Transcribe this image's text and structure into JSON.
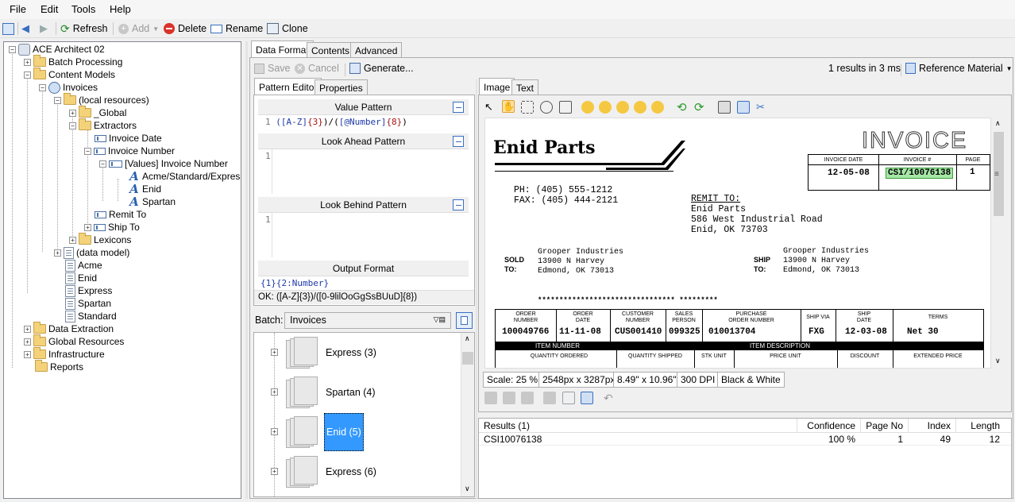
{
  "menu": [
    "File",
    "Edit",
    "Tools",
    "Help"
  ],
  "toolbar": {
    "refresh": "Refresh",
    "add": "Add",
    "delete": "Delete",
    "rename": "Rename",
    "clone": "Clone"
  },
  "tree": {
    "root": "ACE Architect 02",
    "batch_processing": "Batch Processing",
    "content_models": "Content Models",
    "invoices": "Invoices",
    "local_resources": "(local resources)",
    "global": "_Global",
    "extractors": "Extractors",
    "invoice_date": "Invoice Date",
    "invoice_number": "Invoice Number",
    "values_invoice_number": "[Values] Invoice Number",
    "acme": "Acme/Standard/Express",
    "enid": "Enid",
    "spartan": "Spartan",
    "remit_to": "Remit To",
    "ship_to": "Ship To",
    "lexicons": "Lexicons",
    "data_model": "(data model)",
    "acme2": "Acme",
    "enid2": "Enid",
    "express": "Express",
    "spartan2": "Spartan",
    "standard": "Standard",
    "data_extraction": "Data Extraction",
    "global_resources": "Global Resources",
    "infrastructure": "Infrastructure",
    "reports": "Reports"
  },
  "main_tabs": [
    "Data Format",
    "Contents",
    "Advanced"
  ],
  "actions": {
    "save": "Save",
    "cancel": "Cancel",
    "generate": "Generate...",
    "results_timing": "1 results in 3 ms",
    "reference": "Reference Material"
  },
  "editor_tabs": [
    "Pattern Editor",
    "Properties"
  ],
  "value_pattern": {
    "title": "Value Pattern",
    "line": "1",
    "code_a": "([A-Z]",
    "code_b": "{3}",
    "code_c": ")/(",
    "code_d": "[@Number]",
    "code_e": "{8}",
    "code_f": ")"
  },
  "look_ahead": {
    "title": "Look Ahead Pattern",
    "line": "1"
  },
  "look_behind": {
    "title": "Look Behind Pattern",
    "line": "1"
  },
  "output_format": {
    "title": "Output Format",
    "value": "{1}{2:Number}",
    "ok_text": "OK: ([A-Z]{3})/([0-9lilOoGgSsBUuD]{8})"
  },
  "batch": {
    "label": "Batch:",
    "selected": "Invoices",
    "items": [
      "Express (3)",
      "Spartan (4)",
      "Enid (5)",
      "Express (6)"
    ]
  },
  "viewer_tabs": [
    "Image",
    "Text"
  ],
  "status": {
    "scale": "Scale: 25 %",
    "pixels": "2548px x 3287px",
    "inches": "8.49\" x 10.96\"",
    "dpi": "300 DPI",
    "mode": "Black & White"
  },
  "invoice": {
    "company": "Enid Parts",
    "title": "INVOICE",
    "ph": "PH:  (405) 555-1212",
    "fax": "FAX: (405) 444-2121",
    "remit_to_label": "REMIT TO:",
    "remit_lines": [
      "Enid Parts",
      "586 West Industrial Road",
      "Enid, OK 73703"
    ],
    "head_labels": [
      "INVOICE DATE",
      "INVOICE #",
      "PAGE"
    ],
    "head_values": [
      "12-05-08",
      "CSI/10076138",
      "1"
    ],
    "sold_label": "SOLD\nTO:",
    "ship_label": "SHIP\nTO:",
    "sold_lines": [
      "Grooper Industries",
      "13900 N Harvey",
      "Edmond, OK 73013"
    ],
    "ship_lines": [
      "Grooper Industries",
      "13900 N Harvey",
      "Edmond, OK 73013"
    ],
    "stars": "******************************** *********",
    "order_labels": [
      "ORDER\nNUMBER",
      "ORDER\nDATE",
      "CUSTOMER\nNUMBER",
      "SALES\nPERSON",
      "PURCHASE\nORDER NUMBER",
      "SHIP VIA",
      "SHIP\nDATE",
      "TERMS"
    ],
    "order_values": [
      "100049766",
      "11-11-08",
      "CUS001410",
      "099325",
      "010013704",
      "FXG",
      "12-03-08",
      "Net 30"
    ],
    "item_number": "ITEM NUMBER",
    "item_desc": "ITEM DESCRIPTION",
    "col_labels": [
      "QUANTITY ORDERED",
      "QUANTITY SHIPPED",
      "STK UNIT",
      "PRICE UNIT",
      "DISCOUNT",
      "EXTENDED PRICE"
    ]
  },
  "results": {
    "headers": [
      "Results (1)",
      "Confidence",
      "Page No",
      "Index",
      "Length"
    ],
    "row": [
      "CSI10076138",
      "100 %",
      "1",
      "49",
      "12"
    ]
  }
}
